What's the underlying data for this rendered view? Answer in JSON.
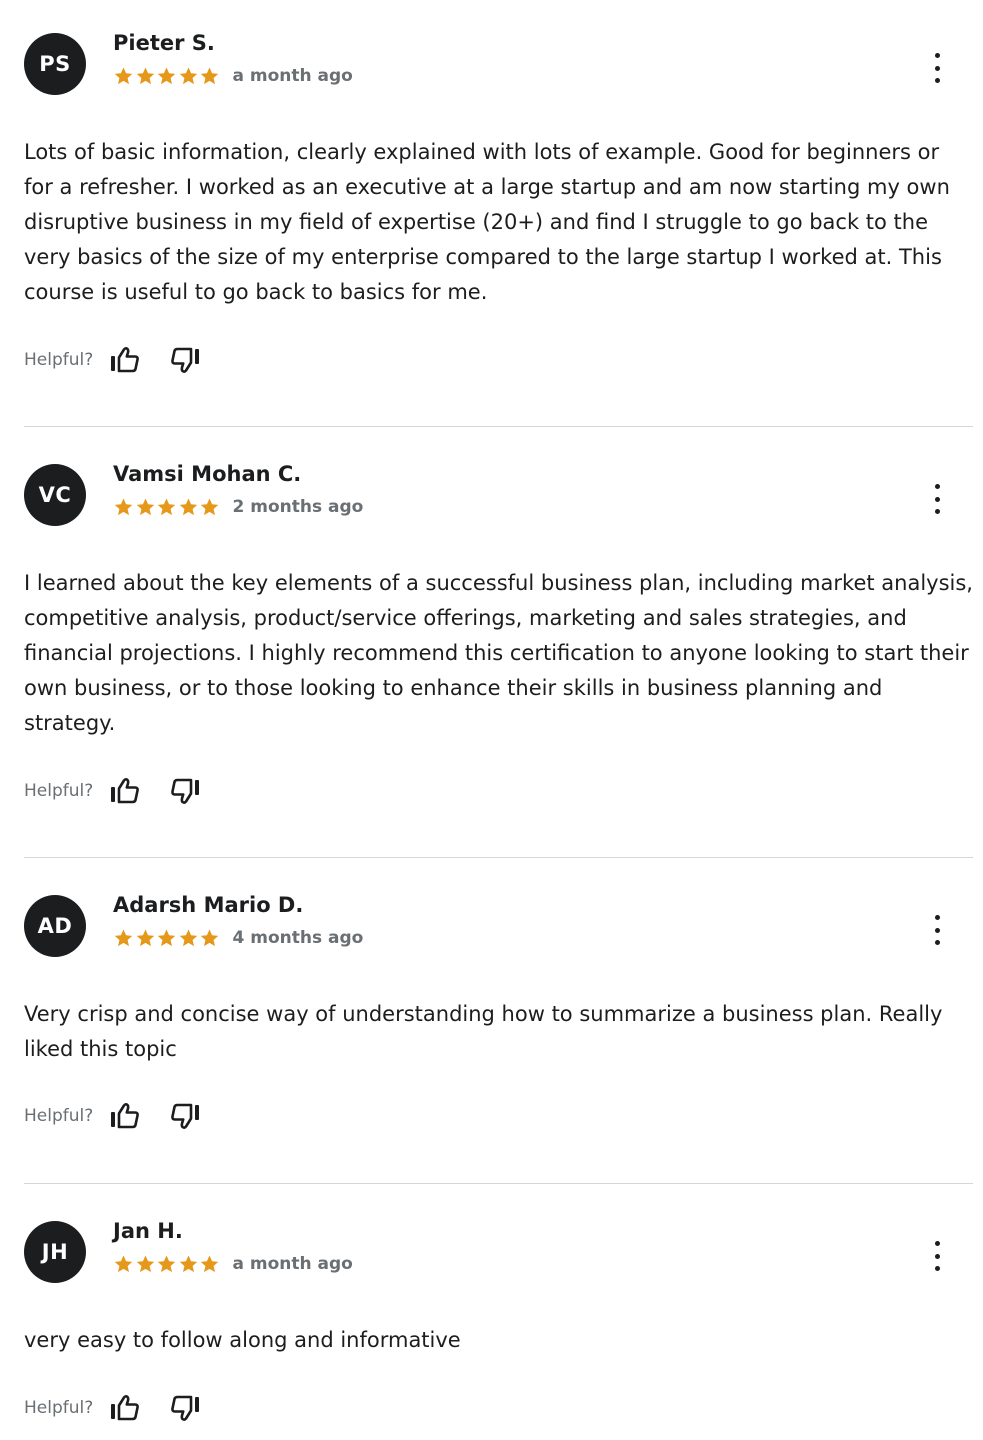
{
  "helpful_label": "Helpful?",
  "star_color": "#e59819",
  "reviews": [
    {
      "initials": "PS",
      "name": "Pieter S.",
      "rating": 5,
      "time": "a month ago",
      "body": "Lots of basic information, clearly explained with lots of example. Good for beginners or for a refresher. I worked as an executive at a large startup and am now starting my own disruptive business in my field of expertise (20+) and find I struggle to go back to the very basics of the size of my enterprise compared to the large startup I worked at. This course is useful to go back to basics for me."
    },
    {
      "initials": "VC",
      "name": "Vamsi Mohan C.",
      "rating": 5,
      "time": "2 months ago",
      "body": "I learned about the key elements of a successful business plan, including market analysis, competitive analysis, product/service offerings, marketing and sales strategies, and financial projections. I highly recommend this certification to anyone looking to start their own business, or to those looking to enhance their skills in business planning and strategy."
    },
    {
      "initials": "AD",
      "name": "Adarsh Mario D.",
      "rating": 5,
      "time": "4 months ago",
      "body": "Very crisp and concise way of understanding how to summarize a business plan. Really liked this topic"
    },
    {
      "initials": "JH",
      "name": "Jan H.",
      "rating": 5,
      "time": "a month ago",
      "body": "very easy to follow along and informative"
    }
  ]
}
